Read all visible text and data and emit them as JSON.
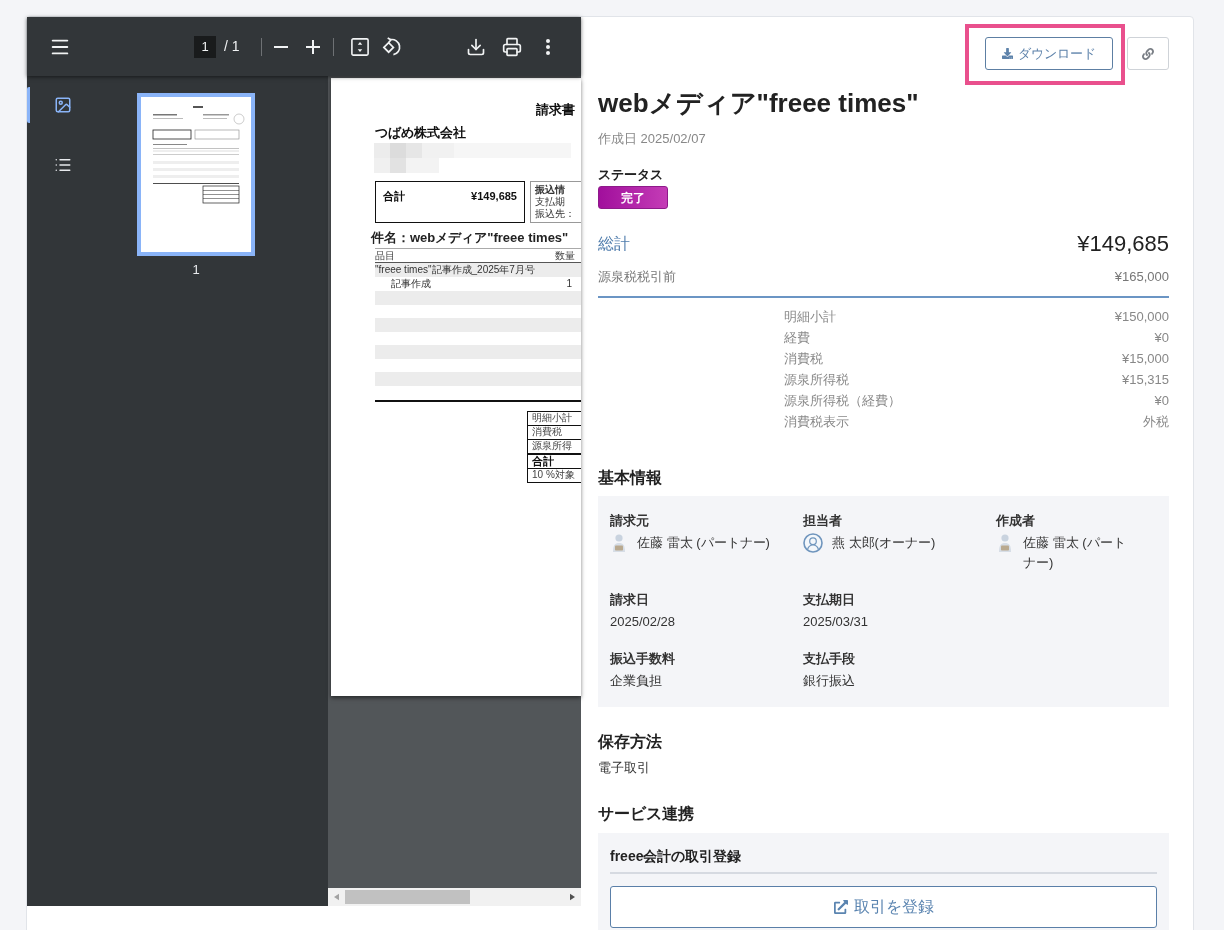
{
  "pdf_viewer": {
    "toolbar": {
      "page_input": "1",
      "page_total": "/ 1"
    },
    "sidebar_tabs": [
      {
        "kind": "thumbnails",
        "selected": true
      },
      {
        "kind": "outline",
        "selected": false
      }
    ],
    "thumbnails": [
      {
        "label": "1",
        "selected": true
      }
    ],
    "document": {
      "title": "請求書",
      "recipient": "つばめ株式会社",
      "total": {
        "label": "合計",
        "value": "¥149,685"
      },
      "bank_info": [
        "振込情",
        "支払期",
        "振込先："
      ],
      "subject": "件名：webメディア\"freee times\"",
      "columns": [
        "品目",
        "数量"
      ],
      "rows": [
        {
          "kind": "group",
          "item": "\"freee times\"記事作成_2025年7月号"
        },
        {
          "kind": "line",
          "item": "記事作成",
          "quantity": "1"
        }
      ],
      "summary": [
        {
          "kind": "row",
          "label": "明細小計"
        },
        {
          "kind": "row",
          "label": "消費税"
        },
        {
          "kind": "row",
          "label": "源泉所得"
        },
        {
          "kind": "total",
          "label": "合計"
        },
        {
          "kind": "row",
          "label": "10 %対象"
        }
      ]
    }
  },
  "detail": {
    "actions": [
      {
        "kind": "download",
        "label": "ダウンロード",
        "highlighted": true
      },
      {
        "kind": "copy_link",
        "highlighted": false
      }
    ],
    "title": "webメディア\"freee times\"",
    "created": "作成日 2025/02/07",
    "status": {
      "label": "ステータス",
      "value": "完了"
    },
    "total": {
      "label": "総計",
      "value": "¥149,685"
    },
    "before_withholding": {
      "label": "源泉税税引前",
      "value": "¥165,000"
    },
    "breakdown": [
      {
        "label": "明細小計",
        "value": "¥150,000"
      },
      {
        "label": "経費",
        "value": "¥0"
      },
      {
        "label": "消費税",
        "value": "¥15,000"
      },
      {
        "label": "源泉所得税",
        "value": "¥15,315"
      },
      {
        "label": "源泉所得税（経費）",
        "value": "¥0"
      },
      {
        "label": "消費税表示",
        "value": "外税"
      }
    ],
    "basic_info": {
      "heading": "基本情報",
      "rows": [
        [
          {
            "kind": "figure",
            "label": "請求元",
            "value": "佐藤 雷太 (パートナー)"
          },
          {
            "kind": "ring",
            "label": "担当者",
            "value": "燕 太郎(オーナー)"
          },
          {
            "kind": "figure",
            "label": "作成者",
            "value": "佐藤 雷太 (パートナー)"
          }
        ],
        [
          {
            "kind": "plain",
            "label": "請求日",
            "value": "2025/02/28"
          },
          {
            "kind": "plain",
            "label": "支払期日",
            "value": "2025/03/31"
          }
        ],
        [
          {
            "kind": "plain",
            "label": "振込手数料",
            "value": "企業負担"
          },
          {
            "kind": "plain",
            "label": "支払手段",
            "value": "銀行振込"
          }
        ]
      ]
    },
    "storage": {
      "heading": "保存方法",
      "value": "電子取引"
    },
    "integration": {
      "heading": "サービス連携",
      "title": "freee会計の取引登録",
      "button": "取引を登録"
    }
  }
}
